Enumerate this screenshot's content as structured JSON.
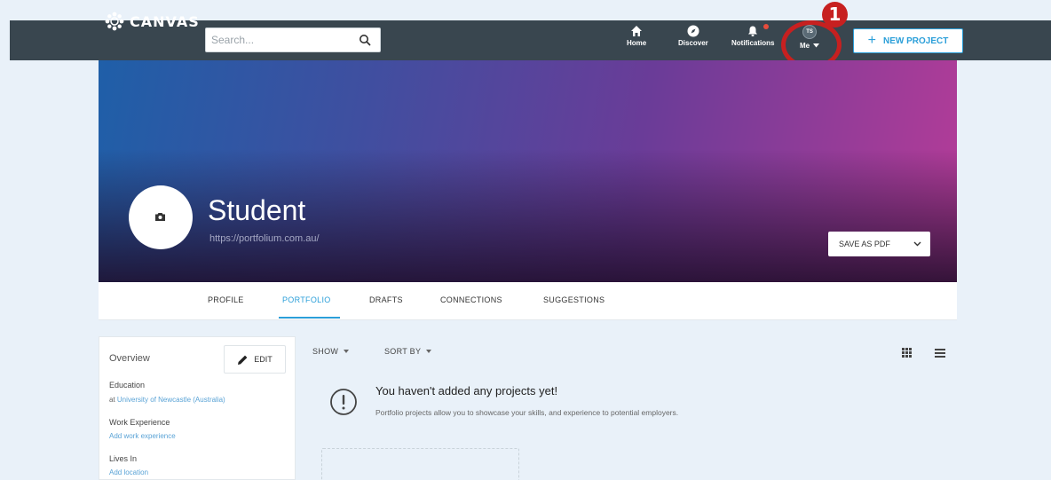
{
  "header": {
    "logo_text": "CANVAS",
    "search_placeholder": "Search...",
    "nav": {
      "home": "Home",
      "discover": "Discover",
      "notifications": "Notifications",
      "me_initials": "TS",
      "me": "Me"
    },
    "new_project_label": "NEW PROJECT",
    "callout_number": "1"
  },
  "profile": {
    "name": "Student",
    "url": "https://portfolium.com.au/",
    "save_pdf_label": "SAVE AS PDF"
  },
  "tabs": [
    {
      "label": "PROFILE"
    },
    {
      "label": "PORTFOLIO",
      "active": true
    },
    {
      "label": "DRAFTS"
    },
    {
      "label": "CONNECTIONS"
    },
    {
      "label": "SUGGESTIONS"
    }
  ],
  "sidebar": {
    "title": "Overview",
    "edit_label": "EDIT",
    "education_label": "Education",
    "education_prefix": "at ",
    "education_value": "University of Newcastle (Australia)",
    "work_label": "Work Experience",
    "work_link": "Add work experience",
    "lives_label": "Lives In",
    "lives_link": "Add location"
  },
  "main": {
    "show_label": "SHOW",
    "sort_label": "SORT BY",
    "empty_title": "You haven't added any projects yet!",
    "empty_desc": "Portfolio projects allow you to showcase your skills, and experience to potential employers."
  },
  "colors": {
    "topbar": "#39464f",
    "accent": "#2b9fd9",
    "callout": "#c72020"
  },
  "icons": [
    "canvas-logo-icon",
    "search-icon",
    "home-icon",
    "compass-icon",
    "bell-icon",
    "chevron-down-icon",
    "plus-icon",
    "camera-icon",
    "pencil-icon",
    "grid-view-icon",
    "list-view-icon",
    "alert-circle-icon"
  ]
}
